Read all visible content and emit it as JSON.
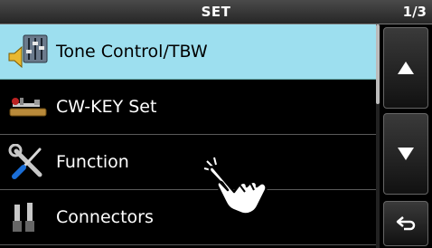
{
  "header": {
    "title": "SET",
    "page": "1/3"
  },
  "menu": {
    "items": [
      {
        "label": "Tone Control/TBW",
        "icon": "tone-control-icon",
        "selected": true
      },
      {
        "label": "CW-KEY Set",
        "icon": "cw-key-icon",
        "selected": false
      },
      {
        "label": "Function",
        "icon": "tools-icon",
        "selected": false
      },
      {
        "label": "Connectors",
        "icon": "connectors-icon",
        "selected": false
      }
    ]
  },
  "side_buttons": {
    "up": "up-arrow-icon",
    "down": "down-arrow-icon",
    "back": "return-icon"
  },
  "colors": {
    "selected_bg": "#9ddfef",
    "background": "#000000"
  }
}
